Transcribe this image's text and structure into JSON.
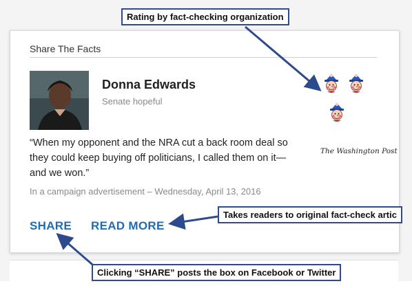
{
  "card": {
    "title": "Share The Facts",
    "person_name": "Donna Edwards",
    "person_role": "Senate hopeful",
    "quote": "“When my opponent and the NRA cut a back room deal so they could keep buying off politicians, I called them on it— and we won.”",
    "source": "In a campaign advertisement – Wednesday, April 13, 2016",
    "publisher": "The Washington Post",
    "rating_icon": "pinocchio-icon",
    "rating_count": 3,
    "share_label": "SHARE",
    "read_more_label": "READ MORE",
    "link_color": "#1f6cb5"
  },
  "callouts": {
    "rating": "Rating by fact-checking organization",
    "read_more": "Takes readers to original fact-check artic",
    "share": "Clicking “SHARE” posts the box on Facebook or Twitter",
    "border_color": "#2c4a8c"
  }
}
